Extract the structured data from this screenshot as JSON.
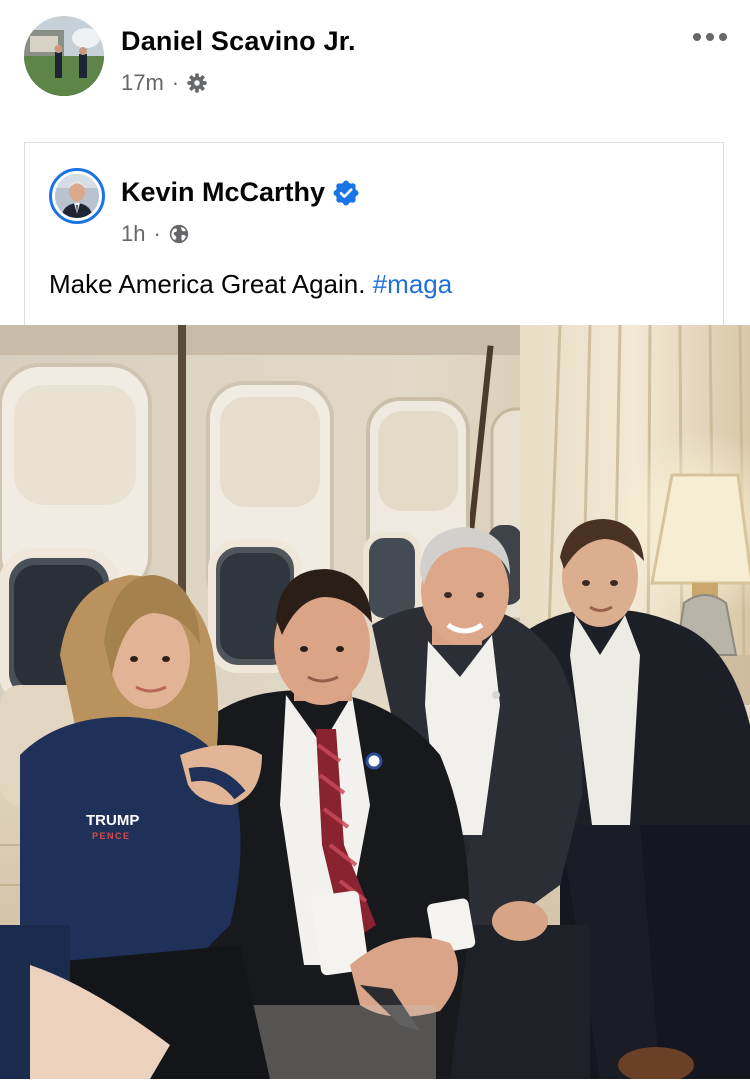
{
  "post": {
    "author": {
      "name": "Daniel Scavino Jr.",
      "avatar_icon": "profile-photo"
    },
    "timestamp": "17m",
    "separator": "·",
    "audience_icon": "gear-icon",
    "more_icon": "more-options-icon"
  },
  "shared_post": {
    "author": {
      "name": "Kevin McCarthy",
      "avatar_icon": "profile-photo",
      "verified": true,
      "verified_icon": "verified-badge-icon"
    },
    "timestamp": "1h",
    "separator": "·",
    "audience_icon": "globe-icon",
    "text": "Make America Great Again.",
    "hashtag": "#maga"
  },
  "photo": {
    "jacket_print": [
      "TRUMP",
      "PENCE"
    ]
  },
  "colors": {
    "link_blue": "#216fdb",
    "verified_blue": "#1b74e4",
    "meta_gray": "#65676b",
    "text_dark": "#050505",
    "card_border": "#dadde1"
  }
}
